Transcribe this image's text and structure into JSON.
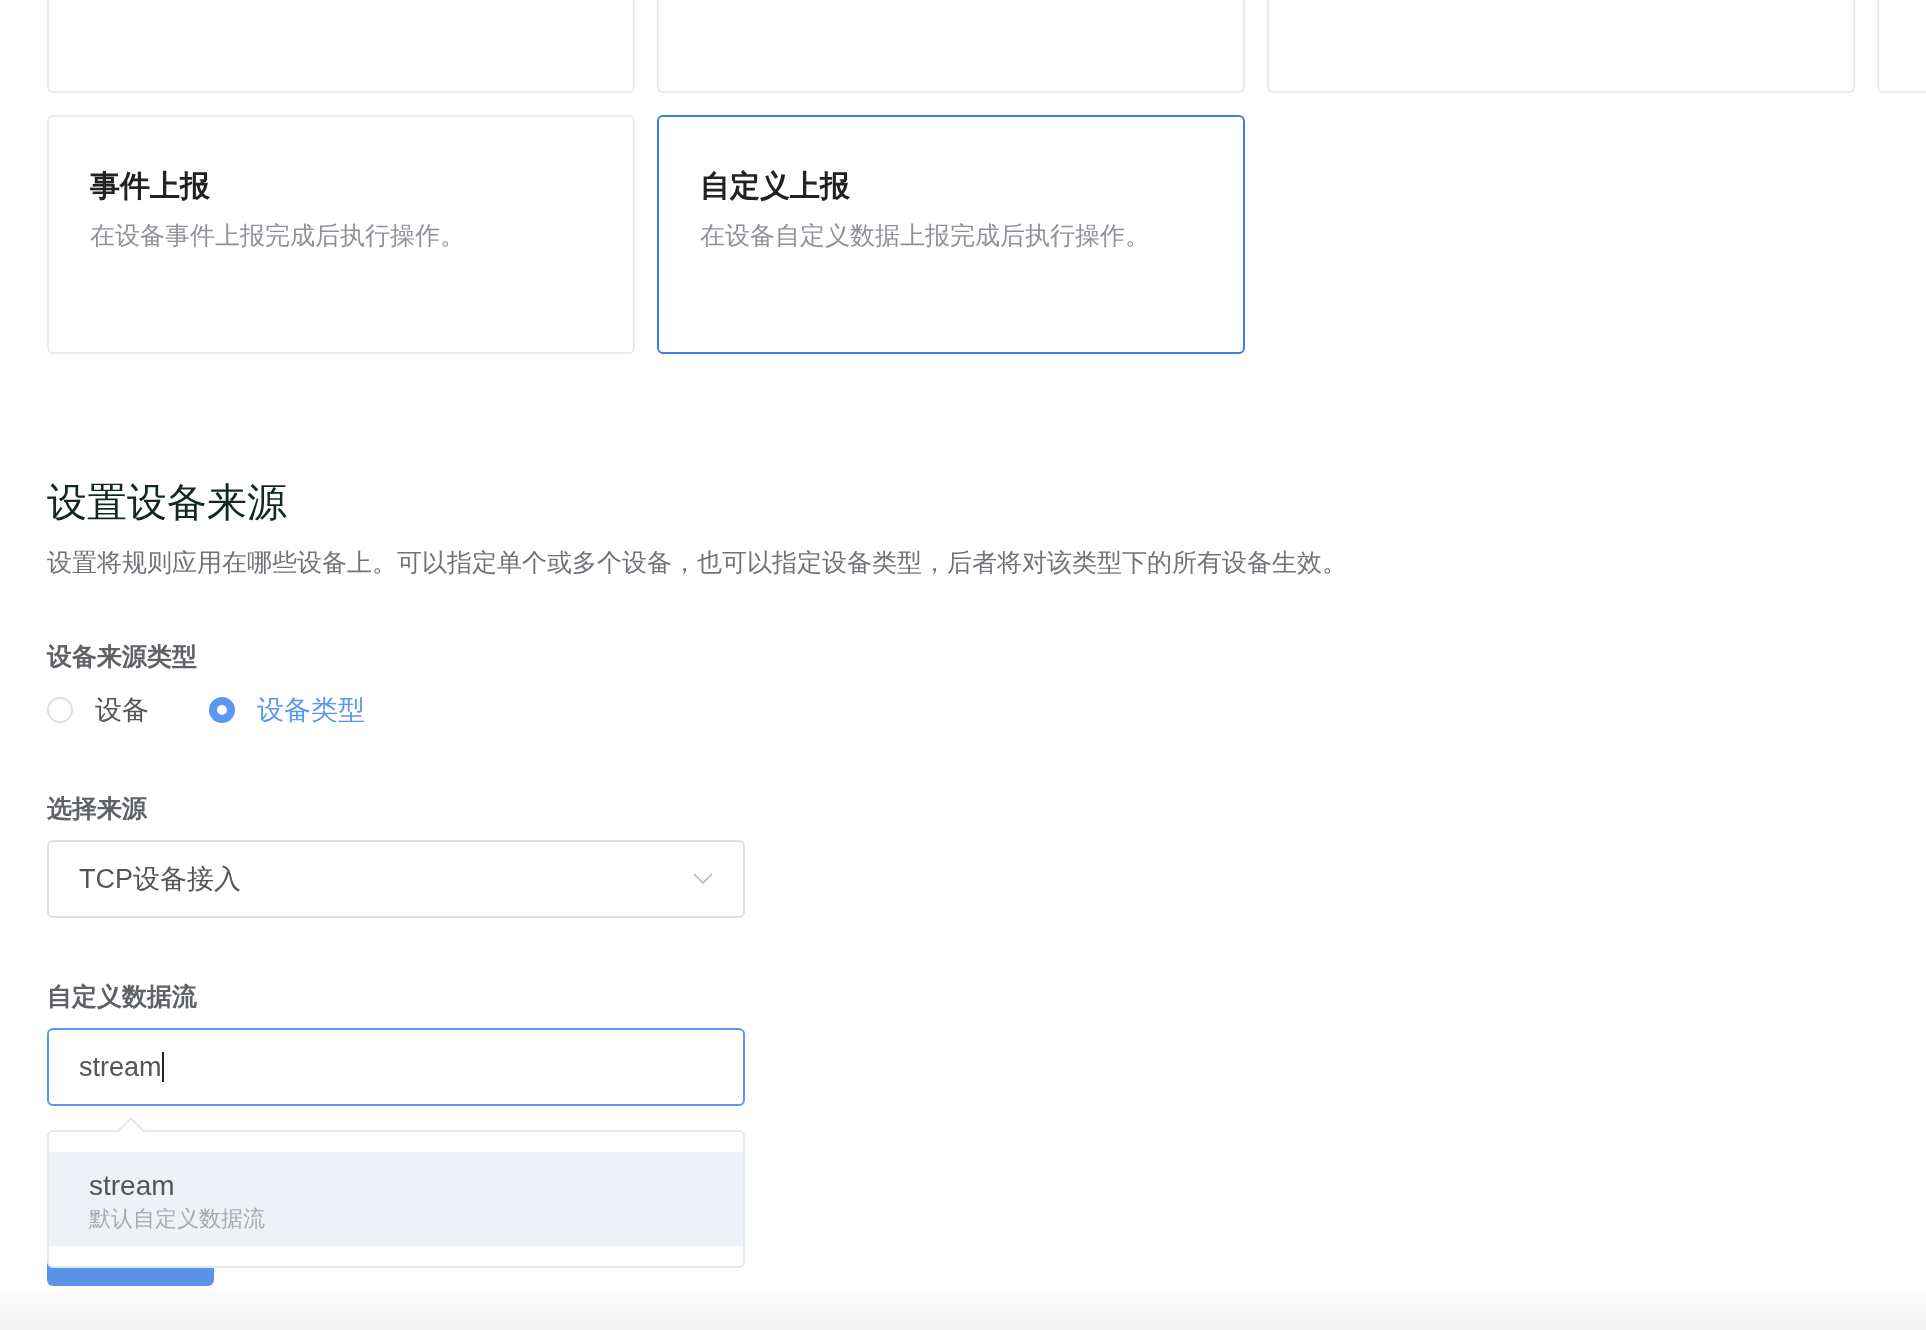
{
  "trigger_cards": [
    {
      "selected": false
    },
    {
      "selected": false
    },
    {
      "selected": false
    },
    {
      "selected": false
    },
    {
      "title": "事件上报",
      "description": "在设备事件上报完成后执行操作。",
      "selected": false
    },
    {
      "title": "自定义上报",
      "description": "在设备自定义数据上报完成后执行操作。",
      "selected": true
    }
  ],
  "source_section": {
    "title": "设置设备来源",
    "description": "设置将规则应用在哪些设备上。可以指定单个或多个设备，也可以指定设备类型，后者将对该类型下的所有设备生效。",
    "source_type": {
      "label": "设备来源类型",
      "options": [
        {
          "label": "设备",
          "selected": false
        },
        {
          "label": "设备类型",
          "selected": true
        }
      ]
    },
    "source_select": {
      "label": "选择来源",
      "value": "TCP设备接入"
    },
    "stream_field": {
      "label": "自定义数据流",
      "value": "stream",
      "focused": true,
      "suggestions": [
        {
          "name": "stream",
          "description": "默认自定义数据流",
          "selected": true
        }
      ]
    }
  }
}
